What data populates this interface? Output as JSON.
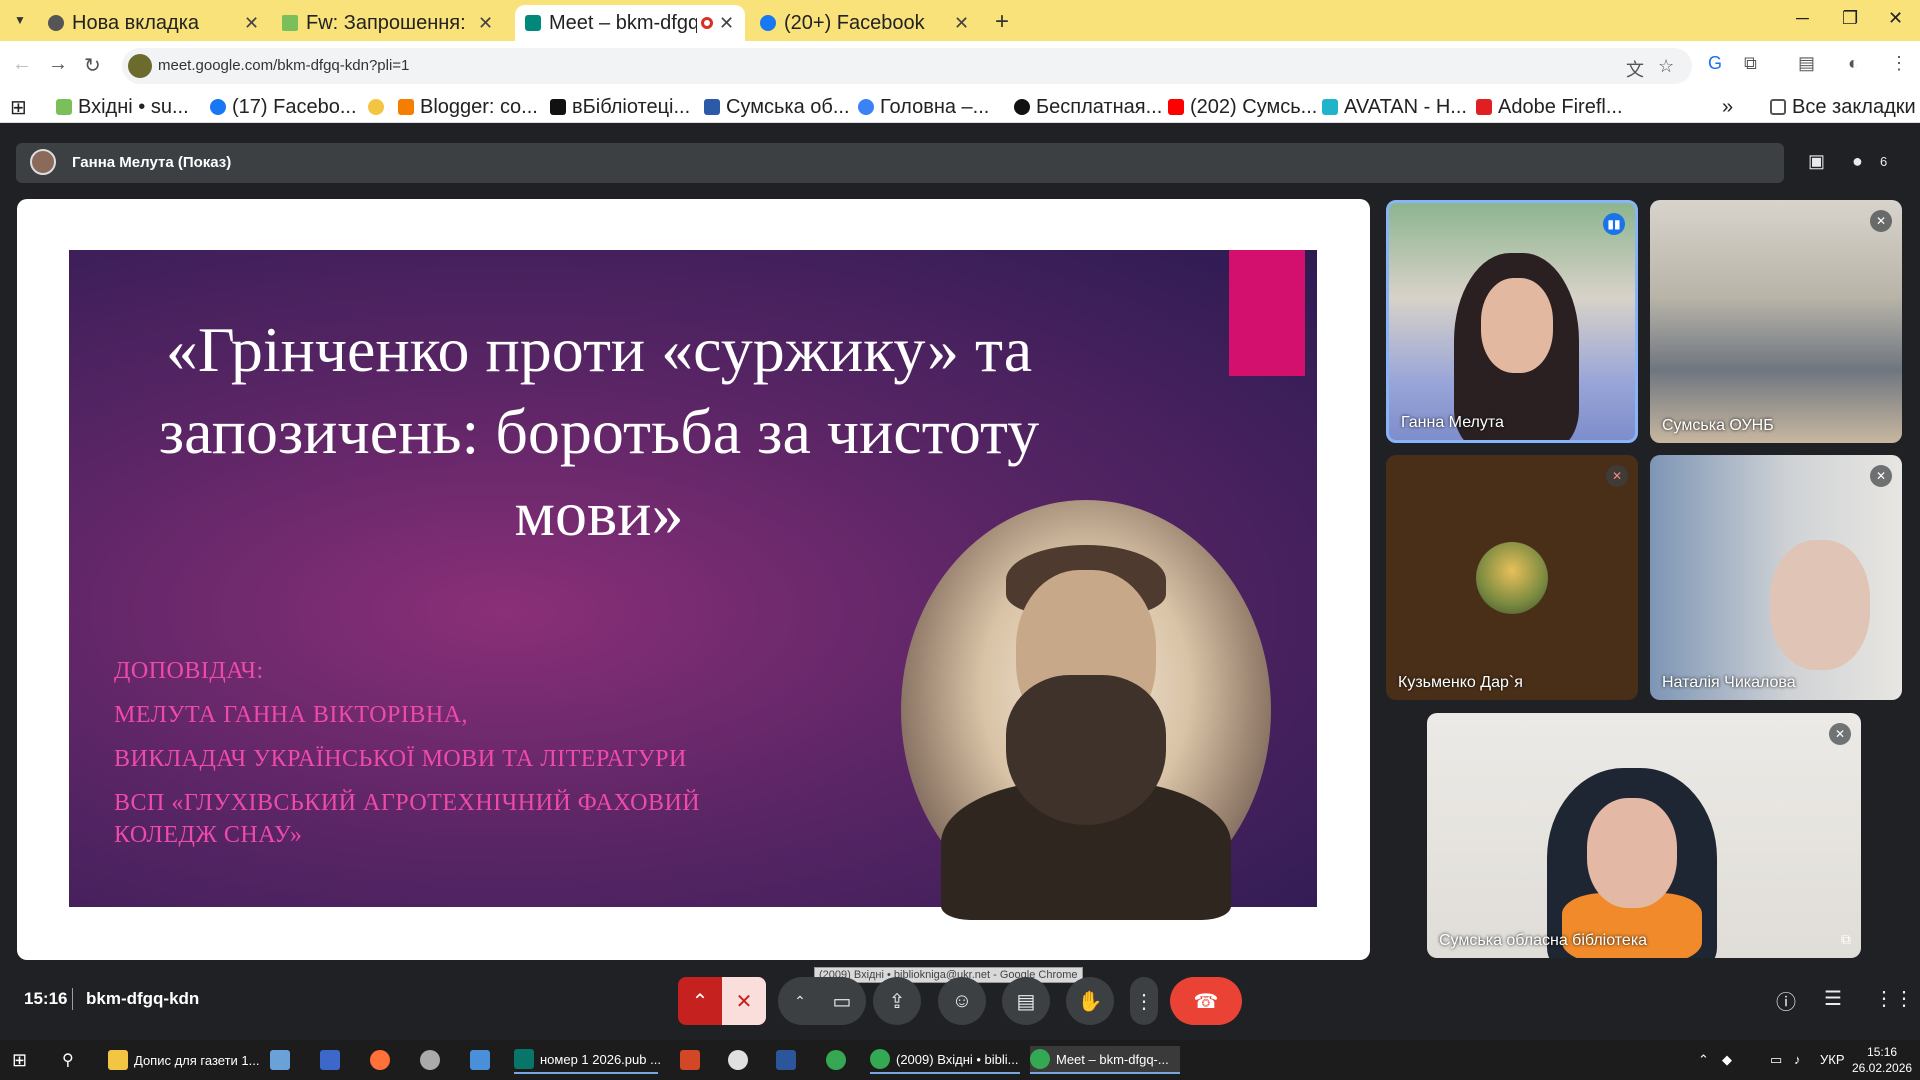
{
  "browser": {
    "tabs": [
      {
        "title": "Нова вкладка",
        "active": false,
        "icon": "chrome-icon"
      },
      {
        "title": "Fw: Запрошення: K",
        "active": false,
        "icon": "mail-icon"
      },
      {
        "title": "Meet – bkm-dfgq",
        "active": true,
        "icon": "meet-icon",
        "recording": true
      },
      {
        "title": "(20+) Facebook",
        "active": false,
        "icon": "facebook-icon"
      }
    ],
    "address": "meet.google.com/bkm-dfgq-kdn?pli=1",
    "bookmarks": [
      "Вхідні • su...",
      "(17) Facebo...",
      "Blogger: co...",
      "вБібліотеці...",
      "Сумська об...",
      "Головна –...",
      "Бесплатная...",
      "(202) Сумсь...",
      "AVATAN - Н...",
      "Adobe Firefl..."
    ],
    "all_bookmarks": "Все закладки",
    "colors": {
      "tabbar": "#f9e27a",
      "accent": "#8ab4f8"
    }
  },
  "meet": {
    "presenter": "Ганна Мелута (Показ)",
    "participant_count": "6",
    "slide": {
      "title_lines": [
        "«Грінченко проти «суржику» та",
        "запозичень: боротьба за чистоту",
        "мови»"
      ],
      "speaker_lines": [
        "ДОПОВІДАЧ:",
        "МЕЛУТА ГАННА ВІКТОРІВНА,",
        "ВИКЛАДАЧ УКРАЇНСЬКОЇ МОВИ ТА ЛІТЕРАТУРИ",
        "ВСП «ГЛУХІВСЬКИЙ АГРОТЕХНІЧНИЙ ФАХОВИЙ",
        "КОЛЕДЖ СНАУ»"
      ],
      "tooltip": "(2009) Вхідні • bibliokniga@ukr.net - Google Chrome",
      "colors": {
        "pink": "#d4106e",
        "speaker": "#ee4aa8"
      }
    },
    "participants": [
      {
        "name": "Ганна Мелута",
        "speaking": true
      },
      {
        "name": "Сумська ОУНБ",
        "muted": true
      },
      {
        "name": "Кузьменко Дар`я",
        "muted": true
      },
      {
        "name": "Наталія Чикалова",
        "muted": true
      },
      {
        "name": "Сумська обласна бібліотека",
        "muted": true
      }
    ],
    "time": "15:16",
    "meeting_code": "bkm-dfgq-kdn"
  },
  "taskbar": {
    "items": [
      "Допис для газети 1...",
      "номер 1 2026.pub ...",
      "(2009) Вхідні • bibli...",
      "Meet – bkm-dfgq-..."
    ],
    "language": "УКР",
    "clock_time": "15:16",
    "clock_date": "26.02.2026"
  }
}
